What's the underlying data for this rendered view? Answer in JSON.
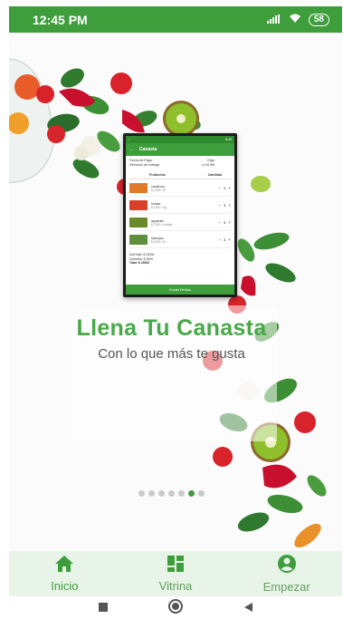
{
  "status_bar": {
    "time": "12:45 PM",
    "battery": "58"
  },
  "preview": {
    "status_time": "8:45",
    "title": "Canasta",
    "payment_label": "Forma de Pago",
    "payment_value": "Orgn",
    "address_label": "Dirección de entrega",
    "address_value": "cr 34 #5t",
    "col_products": "Productos",
    "col_quantity": "Cantidad",
    "items": [
      {
        "name": "zanahoria",
        "price": "$ 1000 / lb",
        "qty": "1"
      },
      {
        "name": "tomate",
        "price": "$ 1500 / kg",
        "qty": "1"
      },
      {
        "name": "aguacate",
        "price": "$ 7000 / unidad",
        "qty": "1"
      },
      {
        "name": "Naranjas",
        "price": "$ 3000 / lb",
        "qty": "1"
      }
    ],
    "subtotal": "SubTotal: $ 20000",
    "delivery": "Domicilio: $ 3000",
    "total": "Total: $ 23000",
    "button": "Enviar Pedido"
  },
  "hero": {
    "title": "Llena Tu Canasta",
    "subtitle": "Con lo que más te gusta"
  },
  "pagination": {
    "count": 7,
    "active_index": 5
  },
  "bottom_nav": {
    "items": [
      {
        "label": "Inicio",
        "icon": "home-icon"
      },
      {
        "label": "Vitrina",
        "icon": "dashboard-icon"
      },
      {
        "label": "Empezar",
        "icon": "account-circle-icon"
      }
    ]
  },
  "colors": {
    "primary": "#3f9e3c",
    "nav_bg": "#e9f4e8",
    "title": "#4aa84a"
  }
}
